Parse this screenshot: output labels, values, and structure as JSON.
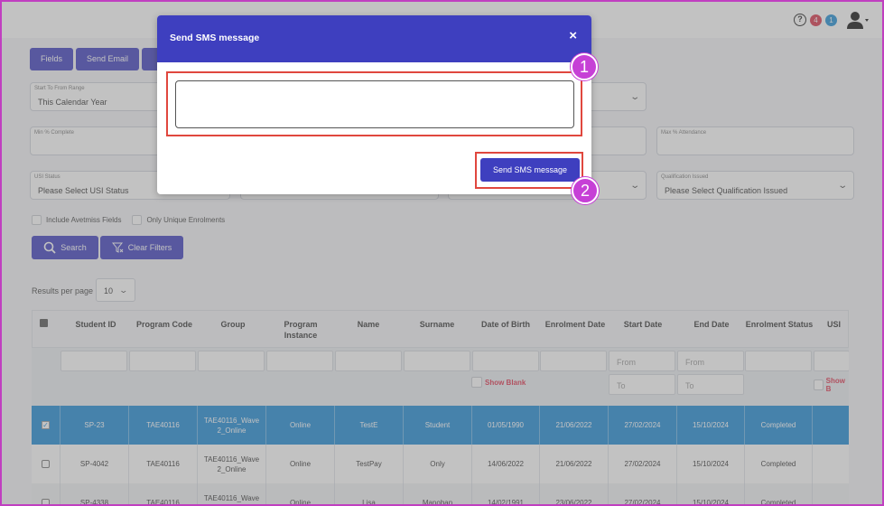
{
  "header": {
    "badge_red": "4",
    "badge_blue": "1"
  },
  "toolbar": {
    "fields_label": "Fields",
    "send_email_label": "Send Email"
  },
  "filters": {
    "start_range": {
      "label": "Start To From Range",
      "value": "This Calendar Year"
    },
    "min_complete": {
      "label": "Min % Complete"
    },
    "max_attendance": {
      "label": "Max % Attendance"
    },
    "usi_status": {
      "label": "USI Status",
      "value": "Please Select USI Status"
    },
    "qualification_issued": {
      "label": "Qualification Issued",
      "value": "Please Select Qualification Issued"
    },
    "include_avetmiss": "Include Avetmiss Fields",
    "only_unique": "Only Unique Enrolments",
    "search_label": "Search",
    "clear_label": "Clear Filters"
  },
  "pagination": {
    "rpp_label": "Results per page",
    "rpp_value": "10"
  },
  "table": {
    "columns": [
      "Student ID",
      "Program Code",
      "Group",
      "Program Instance",
      "Name",
      "Surname",
      "Date of Birth",
      "Enrolment Date",
      "Start Date",
      "End Date",
      "Enrolment Status",
      "USI"
    ],
    "from_placeholder": "From",
    "to_placeholder": "To",
    "show_blank": "Show Blank",
    "show_blank_cut": "Show B",
    "rows": [
      [
        "SP-23",
        "TAE40116",
        "TAE40116_Wave 2_Online",
        "Online",
        "TestE",
        "Student",
        "01/05/1990",
        "21/06/2022",
        "27/02/2024",
        "15/10/2024",
        "Completed"
      ],
      [
        "SP-4042",
        "TAE40116",
        "TAE40116_Wave 2_Online",
        "Online",
        "TestPay",
        "Only",
        "14/06/2022",
        "21/06/2022",
        "27/02/2024",
        "15/10/2024",
        "Completed"
      ],
      [
        "SP-4338",
        "TAE40116",
        "TAE40116_Wave 2_Online",
        "Online",
        "Lisa",
        "Manoban",
        "14/02/1991",
        "23/06/2022",
        "27/02/2024",
        "15/10/2024",
        "Completed"
      ]
    ]
  },
  "modal": {
    "title": "Send SMS message",
    "close": "×",
    "send_label": "Send SMS message",
    "message_value": ""
  },
  "annotations": {
    "one": "1",
    "two": "2"
  }
}
